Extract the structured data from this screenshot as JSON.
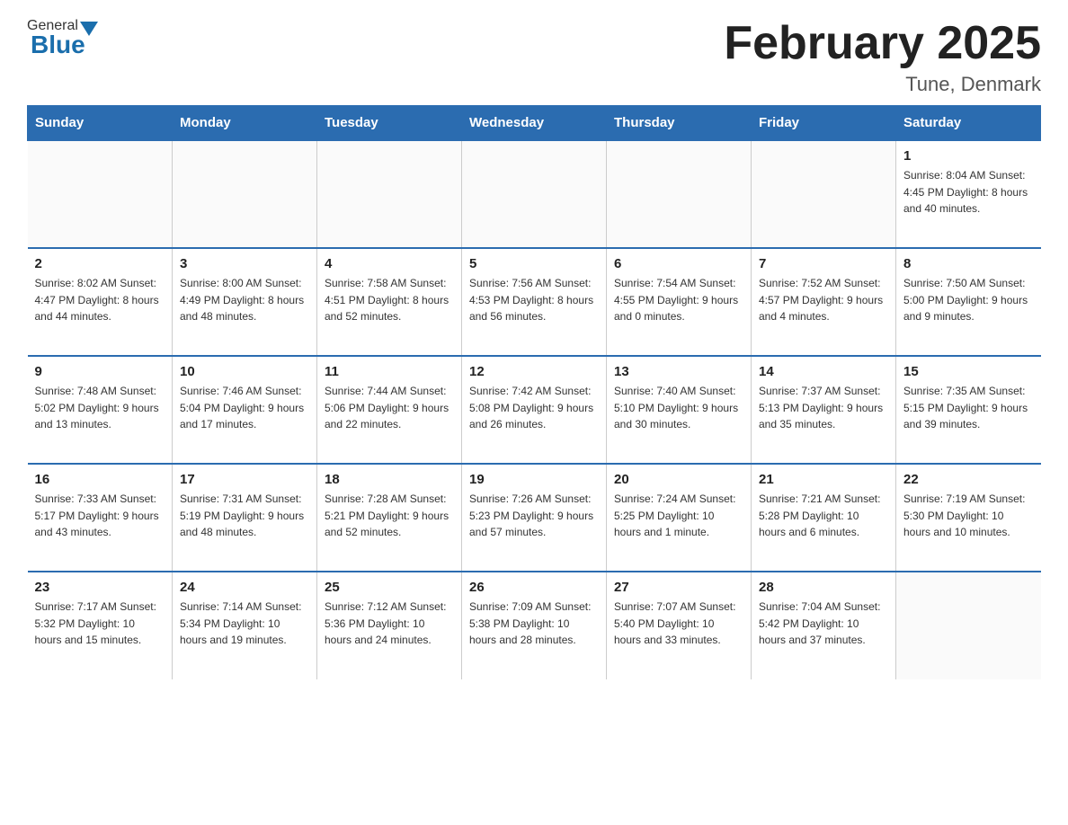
{
  "header": {
    "logo_general": "General",
    "logo_blue": "Blue",
    "title": "February 2025",
    "location": "Tune, Denmark"
  },
  "weekdays": [
    "Sunday",
    "Monday",
    "Tuesday",
    "Wednesday",
    "Thursday",
    "Friday",
    "Saturday"
  ],
  "weeks": [
    [
      {
        "day": "",
        "info": ""
      },
      {
        "day": "",
        "info": ""
      },
      {
        "day": "",
        "info": ""
      },
      {
        "day": "",
        "info": ""
      },
      {
        "day": "",
        "info": ""
      },
      {
        "day": "",
        "info": ""
      },
      {
        "day": "1",
        "info": "Sunrise: 8:04 AM\nSunset: 4:45 PM\nDaylight: 8 hours\nand 40 minutes."
      }
    ],
    [
      {
        "day": "2",
        "info": "Sunrise: 8:02 AM\nSunset: 4:47 PM\nDaylight: 8 hours\nand 44 minutes."
      },
      {
        "day": "3",
        "info": "Sunrise: 8:00 AM\nSunset: 4:49 PM\nDaylight: 8 hours\nand 48 minutes."
      },
      {
        "day": "4",
        "info": "Sunrise: 7:58 AM\nSunset: 4:51 PM\nDaylight: 8 hours\nand 52 minutes."
      },
      {
        "day": "5",
        "info": "Sunrise: 7:56 AM\nSunset: 4:53 PM\nDaylight: 8 hours\nand 56 minutes."
      },
      {
        "day": "6",
        "info": "Sunrise: 7:54 AM\nSunset: 4:55 PM\nDaylight: 9 hours\nand 0 minutes."
      },
      {
        "day": "7",
        "info": "Sunrise: 7:52 AM\nSunset: 4:57 PM\nDaylight: 9 hours\nand 4 minutes."
      },
      {
        "day": "8",
        "info": "Sunrise: 7:50 AM\nSunset: 5:00 PM\nDaylight: 9 hours\nand 9 minutes."
      }
    ],
    [
      {
        "day": "9",
        "info": "Sunrise: 7:48 AM\nSunset: 5:02 PM\nDaylight: 9 hours\nand 13 minutes."
      },
      {
        "day": "10",
        "info": "Sunrise: 7:46 AM\nSunset: 5:04 PM\nDaylight: 9 hours\nand 17 minutes."
      },
      {
        "day": "11",
        "info": "Sunrise: 7:44 AM\nSunset: 5:06 PM\nDaylight: 9 hours\nand 22 minutes."
      },
      {
        "day": "12",
        "info": "Sunrise: 7:42 AM\nSunset: 5:08 PM\nDaylight: 9 hours\nand 26 minutes."
      },
      {
        "day": "13",
        "info": "Sunrise: 7:40 AM\nSunset: 5:10 PM\nDaylight: 9 hours\nand 30 minutes."
      },
      {
        "day": "14",
        "info": "Sunrise: 7:37 AM\nSunset: 5:13 PM\nDaylight: 9 hours\nand 35 minutes."
      },
      {
        "day": "15",
        "info": "Sunrise: 7:35 AM\nSunset: 5:15 PM\nDaylight: 9 hours\nand 39 minutes."
      }
    ],
    [
      {
        "day": "16",
        "info": "Sunrise: 7:33 AM\nSunset: 5:17 PM\nDaylight: 9 hours\nand 43 minutes."
      },
      {
        "day": "17",
        "info": "Sunrise: 7:31 AM\nSunset: 5:19 PM\nDaylight: 9 hours\nand 48 minutes."
      },
      {
        "day": "18",
        "info": "Sunrise: 7:28 AM\nSunset: 5:21 PM\nDaylight: 9 hours\nand 52 minutes."
      },
      {
        "day": "19",
        "info": "Sunrise: 7:26 AM\nSunset: 5:23 PM\nDaylight: 9 hours\nand 57 minutes."
      },
      {
        "day": "20",
        "info": "Sunrise: 7:24 AM\nSunset: 5:25 PM\nDaylight: 10 hours\nand 1 minute."
      },
      {
        "day": "21",
        "info": "Sunrise: 7:21 AM\nSunset: 5:28 PM\nDaylight: 10 hours\nand 6 minutes."
      },
      {
        "day": "22",
        "info": "Sunrise: 7:19 AM\nSunset: 5:30 PM\nDaylight: 10 hours\nand 10 minutes."
      }
    ],
    [
      {
        "day": "23",
        "info": "Sunrise: 7:17 AM\nSunset: 5:32 PM\nDaylight: 10 hours\nand 15 minutes."
      },
      {
        "day": "24",
        "info": "Sunrise: 7:14 AM\nSunset: 5:34 PM\nDaylight: 10 hours\nand 19 minutes."
      },
      {
        "day": "25",
        "info": "Sunrise: 7:12 AM\nSunset: 5:36 PM\nDaylight: 10 hours\nand 24 minutes."
      },
      {
        "day": "26",
        "info": "Sunrise: 7:09 AM\nSunset: 5:38 PM\nDaylight: 10 hours\nand 28 minutes."
      },
      {
        "day": "27",
        "info": "Sunrise: 7:07 AM\nSunset: 5:40 PM\nDaylight: 10 hours\nand 33 minutes."
      },
      {
        "day": "28",
        "info": "Sunrise: 7:04 AM\nSunset: 5:42 PM\nDaylight: 10 hours\nand 37 minutes."
      },
      {
        "day": "",
        "info": ""
      }
    ]
  ]
}
